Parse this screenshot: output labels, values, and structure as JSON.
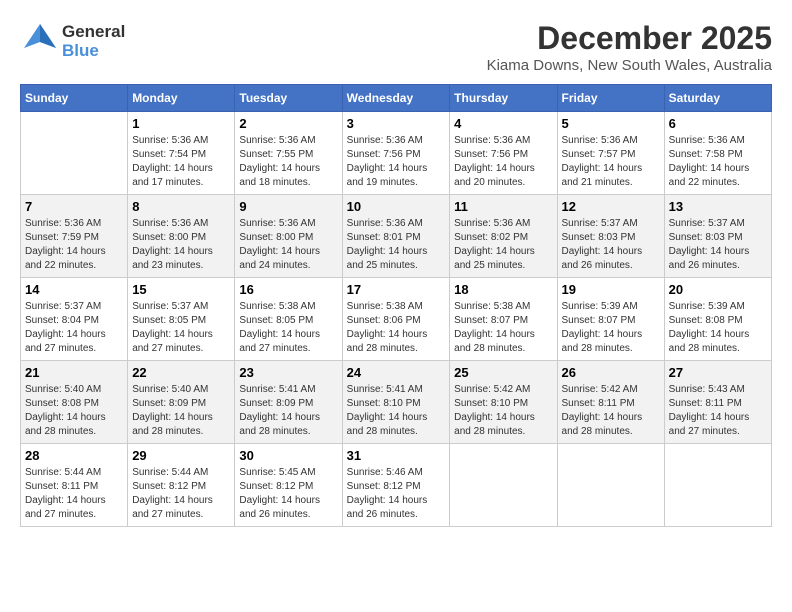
{
  "header": {
    "logo_general": "General",
    "logo_blue": "Blue",
    "title": "December 2025",
    "subtitle": "Kiama Downs, New South Wales, Australia"
  },
  "weekdays": [
    "Sunday",
    "Monday",
    "Tuesday",
    "Wednesday",
    "Thursday",
    "Friday",
    "Saturday"
  ],
  "weeks": [
    [
      {
        "day": "",
        "info": ""
      },
      {
        "day": "1",
        "info": "Sunrise: 5:36 AM\nSunset: 7:54 PM\nDaylight: 14 hours\nand 17 minutes."
      },
      {
        "day": "2",
        "info": "Sunrise: 5:36 AM\nSunset: 7:55 PM\nDaylight: 14 hours\nand 18 minutes."
      },
      {
        "day": "3",
        "info": "Sunrise: 5:36 AM\nSunset: 7:56 PM\nDaylight: 14 hours\nand 19 minutes."
      },
      {
        "day": "4",
        "info": "Sunrise: 5:36 AM\nSunset: 7:56 PM\nDaylight: 14 hours\nand 20 minutes."
      },
      {
        "day": "5",
        "info": "Sunrise: 5:36 AM\nSunset: 7:57 PM\nDaylight: 14 hours\nand 21 minutes."
      },
      {
        "day": "6",
        "info": "Sunrise: 5:36 AM\nSunset: 7:58 PM\nDaylight: 14 hours\nand 22 minutes."
      }
    ],
    [
      {
        "day": "7",
        "info": "Sunrise: 5:36 AM\nSunset: 7:59 PM\nDaylight: 14 hours\nand 22 minutes."
      },
      {
        "day": "8",
        "info": "Sunrise: 5:36 AM\nSunset: 8:00 PM\nDaylight: 14 hours\nand 23 minutes."
      },
      {
        "day": "9",
        "info": "Sunrise: 5:36 AM\nSunset: 8:00 PM\nDaylight: 14 hours\nand 24 minutes."
      },
      {
        "day": "10",
        "info": "Sunrise: 5:36 AM\nSunset: 8:01 PM\nDaylight: 14 hours\nand 25 minutes."
      },
      {
        "day": "11",
        "info": "Sunrise: 5:36 AM\nSunset: 8:02 PM\nDaylight: 14 hours\nand 25 minutes."
      },
      {
        "day": "12",
        "info": "Sunrise: 5:37 AM\nSunset: 8:03 PM\nDaylight: 14 hours\nand 26 minutes."
      },
      {
        "day": "13",
        "info": "Sunrise: 5:37 AM\nSunset: 8:03 PM\nDaylight: 14 hours\nand 26 minutes."
      }
    ],
    [
      {
        "day": "14",
        "info": "Sunrise: 5:37 AM\nSunset: 8:04 PM\nDaylight: 14 hours\nand 27 minutes."
      },
      {
        "day": "15",
        "info": "Sunrise: 5:37 AM\nSunset: 8:05 PM\nDaylight: 14 hours\nand 27 minutes."
      },
      {
        "day": "16",
        "info": "Sunrise: 5:38 AM\nSunset: 8:05 PM\nDaylight: 14 hours\nand 27 minutes."
      },
      {
        "day": "17",
        "info": "Sunrise: 5:38 AM\nSunset: 8:06 PM\nDaylight: 14 hours\nand 28 minutes."
      },
      {
        "day": "18",
        "info": "Sunrise: 5:38 AM\nSunset: 8:07 PM\nDaylight: 14 hours\nand 28 minutes."
      },
      {
        "day": "19",
        "info": "Sunrise: 5:39 AM\nSunset: 8:07 PM\nDaylight: 14 hours\nand 28 minutes."
      },
      {
        "day": "20",
        "info": "Sunrise: 5:39 AM\nSunset: 8:08 PM\nDaylight: 14 hours\nand 28 minutes."
      }
    ],
    [
      {
        "day": "21",
        "info": "Sunrise: 5:40 AM\nSunset: 8:08 PM\nDaylight: 14 hours\nand 28 minutes."
      },
      {
        "day": "22",
        "info": "Sunrise: 5:40 AM\nSunset: 8:09 PM\nDaylight: 14 hours\nand 28 minutes."
      },
      {
        "day": "23",
        "info": "Sunrise: 5:41 AM\nSunset: 8:09 PM\nDaylight: 14 hours\nand 28 minutes."
      },
      {
        "day": "24",
        "info": "Sunrise: 5:41 AM\nSunset: 8:10 PM\nDaylight: 14 hours\nand 28 minutes."
      },
      {
        "day": "25",
        "info": "Sunrise: 5:42 AM\nSunset: 8:10 PM\nDaylight: 14 hours\nand 28 minutes."
      },
      {
        "day": "26",
        "info": "Sunrise: 5:42 AM\nSunset: 8:11 PM\nDaylight: 14 hours\nand 28 minutes."
      },
      {
        "day": "27",
        "info": "Sunrise: 5:43 AM\nSunset: 8:11 PM\nDaylight: 14 hours\nand 27 minutes."
      }
    ],
    [
      {
        "day": "28",
        "info": "Sunrise: 5:44 AM\nSunset: 8:11 PM\nDaylight: 14 hours\nand 27 minutes."
      },
      {
        "day": "29",
        "info": "Sunrise: 5:44 AM\nSunset: 8:12 PM\nDaylight: 14 hours\nand 27 minutes."
      },
      {
        "day": "30",
        "info": "Sunrise: 5:45 AM\nSunset: 8:12 PM\nDaylight: 14 hours\nand 26 minutes."
      },
      {
        "day": "31",
        "info": "Sunrise: 5:46 AM\nSunset: 8:12 PM\nDaylight: 14 hours\nand 26 minutes."
      },
      {
        "day": "",
        "info": ""
      },
      {
        "day": "",
        "info": ""
      },
      {
        "day": "",
        "info": ""
      }
    ]
  ]
}
